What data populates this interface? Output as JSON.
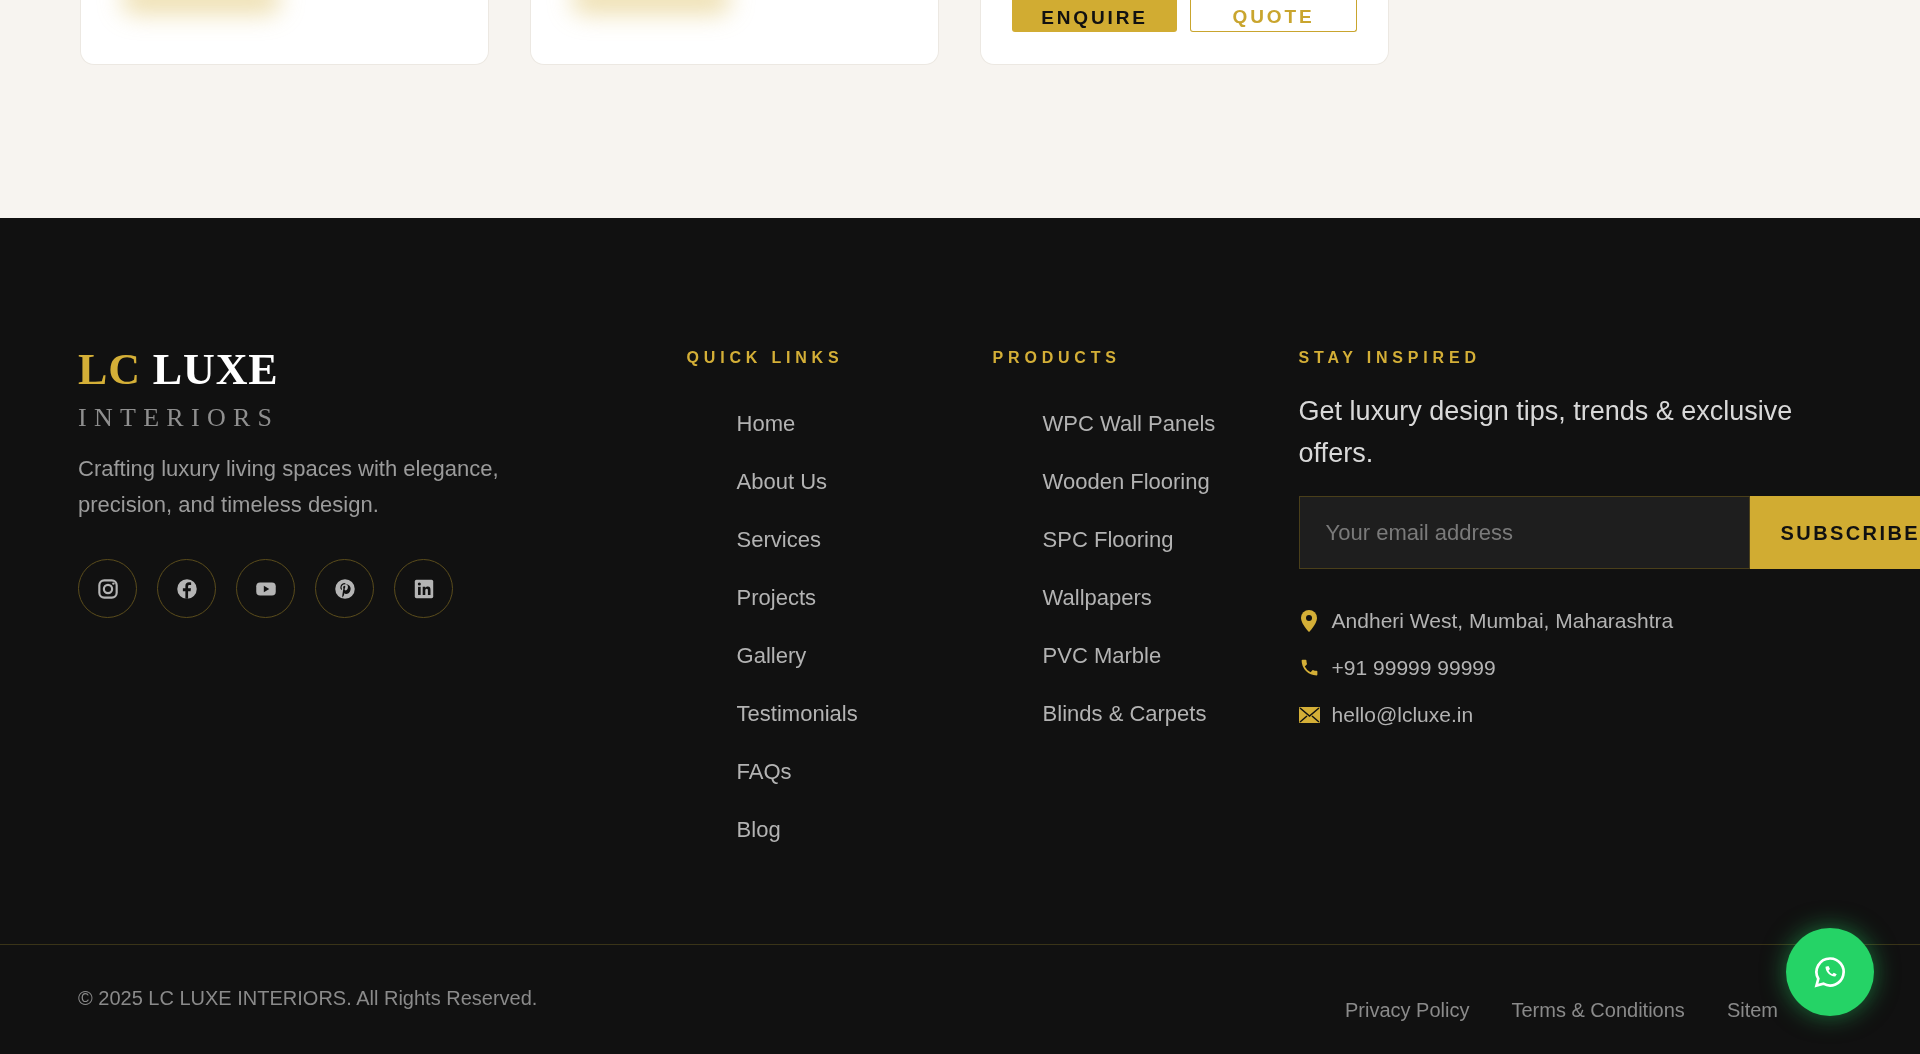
{
  "cards": [
    {
      "kind": "image"
    },
    {
      "kind": "image"
    },
    {
      "kind": "actions",
      "buttons": [
        {
          "label": "ENQUIRE",
          "kind": "primary"
        },
        {
          "label": "QUOTE",
          "kind": "outline"
        }
      ]
    }
  ],
  "footer": {
    "brand": {
      "logo_accent": "LC",
      "logo_main": "LUXE",
      "logo_sub": "INTERIORS",
      "tagline": "Crafting luxury living spaces with elegance, precision, and timeless design.",
      "social": [
        {
          "kind": "instagram"
        },
        {
          "kind": "facebook"
        },
        {
          "kind": "youtube"
        },
        {
          "kind": "pinterest"
        },
        {
          "kind": "linkedin"
        }
      ]
    },
    "columns": [
      {
        "heading": "QUICK LINKS",
        "links": [
          "Home",
          "About Us",
          "Services",
          "Projects",
          "Gallery",
          "Testimonials",
          "FAQs",
          "Blog"
        ]
      },
      {
        "heading": "PRODUCTS",
        "links": [
          "WPC Wall Panels",
          "Wooden Flooring",
          "SPC Flooring",
          "Wallpapers",
          "PVC Marble",
          "Blinds & Carpets"
        ]
      }
    ],
    "newsletter": {
      "heading": "STAY INSPIRED",
      "text": "Get luxury design tips, trends & exclusive offers.",
      "placeholder": "Your email address",
      "button": "SUBSCRIBE",
      "contacts": [
        {
          "kind": "location",
          "text": "Andheri West, Mumbai, Maharashtra"
        },
        {
          "kind": "phone",
          "text": "+91 99999 99999"
        },
        {
          "kind": "email",
          "text": "hello@lcluxe.in"
        }
      ]
    },
    "copyright": "© 2025 LC LUXE INTERIORS. All Rights Reserved.",
    "legal_links": [
      "Privacy Policy",
      "Terms & Conditions",
      "Sitem"
    ]
  }
}
